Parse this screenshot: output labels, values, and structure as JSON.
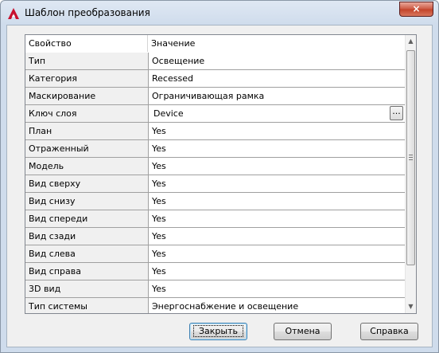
{
  "window": {
    "title": "Шаблон преобразования",
    "close_glyph": "×",
    "app_icon": "autocad-a-icon",
    "accent": "#c8102e"
  },
  "grid": {
    "headers": [
      "Свойство",
      "Значение"
    ],
    "rows": [
      {
        "property": "Тип",
        "value": "Освещение"
      },
      {
        "property": "Категория",
        "value": "Recessed"
      },
      {
        "property": "Маскирование",
        "value": "Ограничивающая рамка"
      },
      {
        "property": "Ключ слоя",
        "value": "Device",
        "browse": "..."
      },
      {
        "property": "План",
        "value": "Yes"
      },
      {
        "property": "Отраженный",
        "value": "Yes"
      },
      {
        "property": "Модель",
        "value": "Yes"
      },
      {
        "property": "Вид сверху",
        "value": "Yes"
      },
      {
        "property": "Вид снизу",
        "value": "Yes"
      },
      {
        "property": "Вид спереди",
        "value": "Yes"
      },
      {
        "property": "Вид сзади",
        "value": "Yes"
      },
      {
        "property": "Вид слева",
        "value": "Yes"
      },
      {
        "property": "Вид справа",
        "value": "Yes"
      },
      {
        "property": "3D вид",
        "value": "Yes"
      },
      {
        "property": "Тип системы",
        "value": "Энергоснабжение и освещение"
      }
    ],
    "scroll_up_glyph": "▲",
    "scroll_down_glyph": "▼"
  },
  "buttons": {
    "close": "Закрыть",
    "cancel": "Отмена",
    "help": "Справка"
  }
}
